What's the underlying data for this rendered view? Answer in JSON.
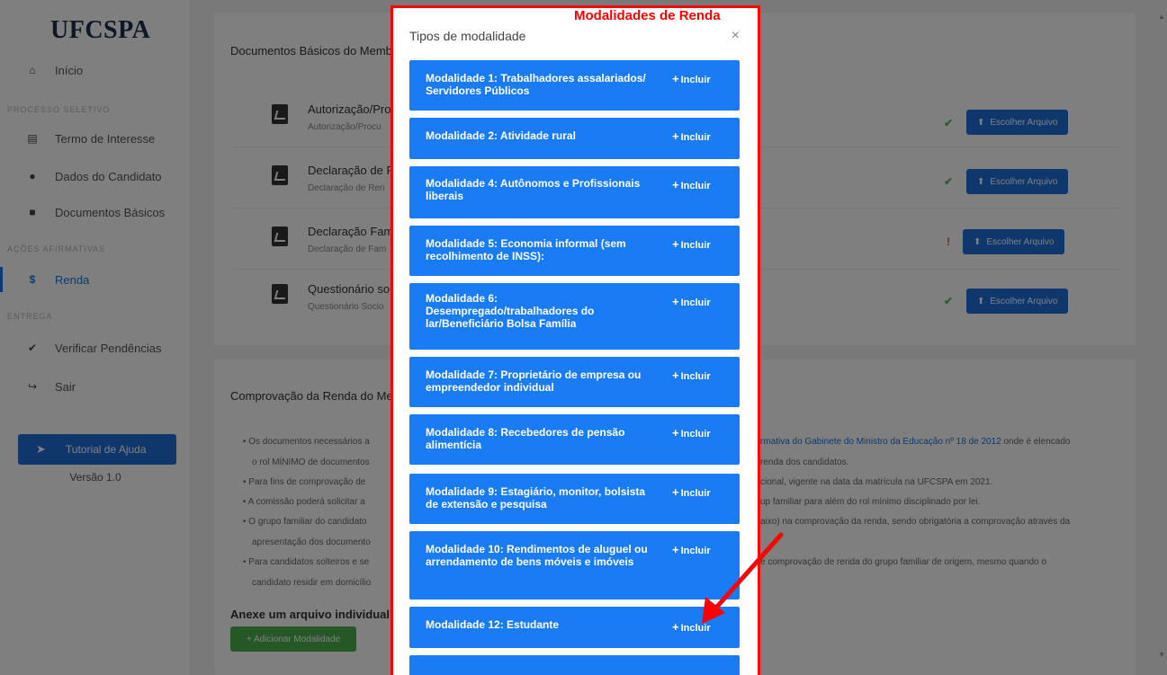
{
  "sidebar": {
    "logo": "UFCSPA",
    "items": [
      {
        "icon": "⌂",
        "label": "Início"
      },
      {
        "icon": "▤",
        "label": "Termo de Interesse"
      },
      {
        "icon": "●",
        "label": "Dados do Candidato"
      },
      {
        "icon": "■",
        "label": "Documentos Básicos"
      },
      {
        "icon": "$",
        "label": "Renda"
      },
      {
        "icon": "✔",
        "label": "Verificar Pendências"
      },
      {
        "icon": "↪",
        "label": "Sair"
      }
    ],
    "sections": {
      "processo": "PROCESSO SELETIVO",
      "acoes": "AÇÕES AFIRMATIVAS",
      "entrega": "ENTREGA"
    },
    "help_button": "Tutorial de Ajuda",
    "version": "Versão 1.0"
  },
  "main": {
    "docs_card_title": "Documentos Básicos do Memb",
    "documents": [
      {
        "title": "Autorização/Pro",
        "subtitle": "Autorização/Procu",
        "status": "ok"
      },
      {
        "title": "Declaração de F",
        "subtitle": "Declaração de Ren",
        "status": "ok"
      },
      {
        "title": "Declaração Fam",
        "subtitle": "Declaração de Fam",
        "status": "pending"
      },
      {
        "title": "Questionário so",
        "subtitle": "Questionário Socio",
        "status": "ok"
      }
    ],
    "choose_file_label": "Escolher Arquivo",
    "status_ok_icon": "✔",
    "status_pending_icon": "!",
    "income_card_title": "Comprovação da Renda do Me",
    "bullets_left": [
      "• Os documentos necessários a",
      "o rol MÍNIMO de documentos",
      "• Para fins de comprovação de",
      "• A comissão poderá solicitar a",
      "• O grupo familiar do candidato",
      "apresentação dos documento",
      "• Para candidatos solteiros e se",
      "candidato residir em domicílio"
    ],
    "bullets_right": [
      "rmativa do Gabinete do Ministro da Educação nº 18 de 2012",
      " onde é elencado",
      "renda dos candidatos.",
      "cional, vigente na data da matrícula na UFCSPA em 2021.",
      "up familiar para além do rol mínimo disciplinado por lei.",
      "aixo) na comprovação da renda, sendo obrigatória a comprovação através da",
      "e comprovação de renda do grupo familiar de origem, mesmo quando o"
    ],
    "attach_label": "Anexe um arquivo individual p",
    "add_modality_button": "+ Adicionar Modalidade"
  },
  "modal": {
    "title": "Tipos de modalidade",
    "close_icon": "×",
    "include_label": "Incluir",
    "items": [
      {
        "name": "Modalidade 1: Trabalhadores assalariados/ Servidores Públicos"
      },
      {
        "name": "Modalidade 2: Atividade rural"
      },
      {
        "name": "Modalidade 4: Autônomos e Profissionais liberais"
      },
      {
        "name": "Modalidade 5: Economia informal (sem recolhimento de INSS):"
      },
      {
        "name": "Modalidade 6: Desempregado/trabalhadores do lar/Beneficiário Bolsa Família"
      },
      {
        "name": "Modalidade 7: Proprietário de empresa ou empreendedor individual"
      },
      {
        "name": "Modalidade 8: Recebedores de pensão alimentícia"
      },
      {
        "name": "Modalidade 9: Estagiário, monitor, bolsista de extensão e pesquisa"
      },
      {
        "name": "Modalidade 10: Rendimentos de aluguel ou arrendamento de bens móveis e imóveis"
      },
      {
        "name": "Modalidade 12: Estudante"
      }
    ]
  },
  "annotation": {
    "label": "Modalidades de Renda",
    "color": "#ff0000"
  },
  "colors": {
    "primary": "#1e6fd9",
    "modal_item": "#1a7cf5",
    "success": "#4cae4c",
    "ok_check": "#5cb85c",
    "pending": "#d9534f"
  }
}
